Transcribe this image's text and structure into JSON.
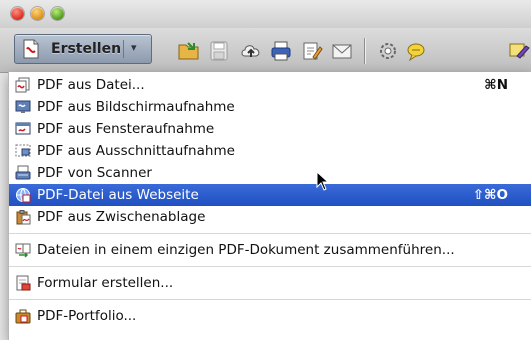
{
  "window": {
    "controls": [
      "close",
      "minimize",
      "zoom"
    ]
  },
  "toolbar": {
    "create_label": "Erstellen",
    "icons": [
      "folder-open-icon",
      "save-icon",
      "upload-icon",
      "print-icon",
      "edit-icon",
      "mail-icon",
      "settings-icon",
      "comment-icon",
      "stamp-icon"
    ]
  },
  "menu": {
    "items": [
      {
        "label": "PDF aus Datei...",
        "shortcut": "⌘N",
        "icon": "pdf-from-file-icon"
      },
      {
        "label": "PDF aus Bildschirmaufnahme",
        "shortcut": "",
        "icon": "screenshot-icon"
      },
      {
        "label": "PDF aus Fensteraufnahme",
        "shortcut": "",
        "icon": "window-capture-icon"
      },
      {
        "label": "PDF aus Ausschnittaufnahme",
        "shortcut": "",
        "icon": "selection-capture-icon"
      },
      {
        "label": "PDF von Scanner",
        "shortcut": "",
        "icon": "scanner-icon"
      },
      {
        "label": "PDF-Datei aus Webseite",
        "shortcut": "⇧⌘O",
        "icon": "webpage-icon",
        "selected": true
      },
      {
        "label": "PDF aus Zwischenablage",
        "shortcut": "",
        "icon": "clipboard-icon"
      },
      {
        "label": "Dateien in einem einzigen PDF-Dokument zusammenführen...",
        "shortcut": "",
        "icon": "combine-files-icon"
      },
      {
        "label": "Formular erstellen...",
        "shortcut": "",
        "icon": "form-icon"
      },
      {
        "label": "PDF-Portfolio...",
        "shortcut": "",
        "icon": "portfolio-icon"
      }
    ]
  },
  "colors": {
    "selection": "#2a5bd0",
    "toolbar": "#c9c9c9"
  }
}
